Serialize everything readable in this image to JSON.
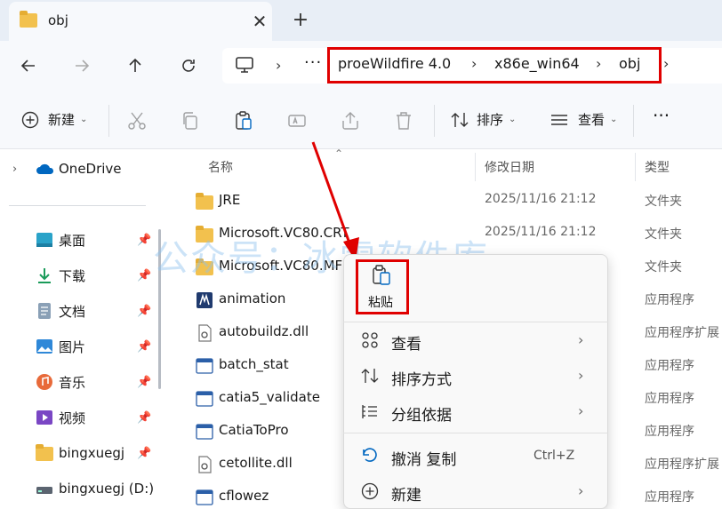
{
  "tab": {
    "title": "obj",
    "close": "✕",
    "new": "+"
  },
  "breadcrumb": {
    "more": "···",
    "items": [
      "proeWildfire 4.0",
      "x86e_win64",
      "obj"
    ]
  },
  "toolbar": {
    "new_label": "新建",
    "sort_label": "排序",
    "view_label": "查看",
    "more": "···"
  },
  "sidebar": {
    "onedrive": "OneDrive",
    "items": [
      {
        "label": "桌面",
        "icon": "desktop-icon"
      },
      {
        "label": "下载",
        "icon": "download-icon"
      },
      {
        "label": "文档",
        "icon": "document-icon"
      },
      {
        "label": "图片",
        "icon": "picture-icon"
      },
      {
        "label": "音乐",
        "icon": "music-icon"
      },
      {
        "label": "视频",
        "icon": "video-icon"
      },
      {
        "label": "bingxuegj",
        "icon": "folder-icon"
      },
      {
        "label": "bingxuegj (D:)",
        "icon": "drive-icon"
      }
    ]
  },
  "columns": {
    "name": "名称",
    "date": "修改日期",
    "type": "类型"
  },
  "files": [
    {
      "name": "JRE",
      "date": "2025/11/16 21:12",
      "type": "文件夹",
      "icon": "folder-icon"
    },
    {
      "name": "Microsoft.VC80.CRT",
      "date": "2025/11/16 21:12",
      "type": "文件夹",
      "icon": "folder-icon"
    },
    {
      "name": "Microsoft.VC80.MF",
      "date": "",
      "type": "文件夹",
      "icon": "folder-icon"
    },
    {
      "name": "animation",
      "date": "",
      "type": "应用程序",
      "icon": "app-icon"
    },
    {
      "name": "autobuildz.dll",
      "date": "",
      "type": "应用程序扩展",
      "icon": "dll-icon"
    },
    {
      "name": "batch_stat",
      "date": "",
      "type": "应用程序",
      "icon": "exe-icon"
    },
    {
      "name": "catia5_validate",
      "date": "",
      "type": "应用程序",
      "icon": "exe-icon"
    },
    {
      "name": "CatiaToPro",
      "date": "",
      "type": "应用程序",
      "icon": "exe-icon"
    },
    {
      "name": "cetollite.dll",
      "date": "",
      "type": "应用程序扩展",
      "icon": "dll-icon"
    },
    {
      "name": "cflowez",
      "date": "",
      "type": "应用程序",
      "icon": "exe-icon"
    }
  ],
  "context_menu": {
    "paste": "粘贴",
    "items": [
      {
        "label": "查看",
        "icon": "grid-icon",
        "submenu": true
      },
      {
        "label": "排序方式",
        "icon": "sort-icon",
        "submenu": true
      },
      {
        "label": "分组依据",
        "icon": "group-icon",
        "submenu": true
      },
      {
        "label": "撤消 复制",
        "icon": "undo-icon",
        "shortcut": "Ctrl+Z"
      },
      {
        "label": "新建",
        "icon": "add-icon",
        "submenu": true
      }
    ]
  },
  "watermark": "公众号：冰雪软件库",
  "colors": {
    "accent": "#0067c0",
    "highlight": "#e00000",
    "folder": "#f2c14e"
  }
}
